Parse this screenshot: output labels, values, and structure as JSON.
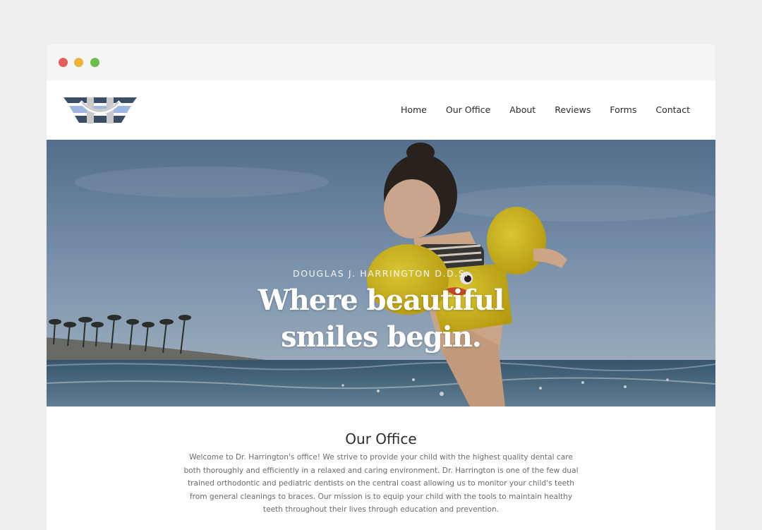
{
  "window": {
    "controls": [
      "close",
      "minimize",
      "maximize"
    ]
  },
  "brand": {
    "logo_icon": "harrington-h-smile-logo",
    "colors": {
      "dark": "#3b4d67",
      "light": "#9fb6e0",
      "silver": "#c9c9c9"
    }
  },
  "nav": {
    "items": [
      {
        "label": "Home"
      },
      {
        "label": "Our Office"
      },
      {
        "label": "About"
      },
      {
        "label": "Reviews"
      },
      {
        "label": "Forms"
      },
      {
        "label": "Contact"
      }
    ]
  },
  "hero": {
    "eyebrow": "DOUGLAS J. HARRINGTON D.D.S.",
    "title_line1": "Where beautiful",
    "title_line2": "smiles begin.",
    "image": "child-with-yellow-floaties-jumping-in-ocean"
  },
  "office": {
    "heading": "Our Office",
    "body": "Welcome to Dr. Harrington's office! We strive to provide your child with the highest quality dental care both thoroughly and efficiently in a relaxed and caring environment. Dr. Harrington is one of the few dual trained orthodontic and pediatric dentists on the central coast allowing us to monitor your child's teeth from general cleanings to braces. Our mission is to equip your child with the tools to maintain healthy teeth throughout their lives through education and prevention."
  }
}
